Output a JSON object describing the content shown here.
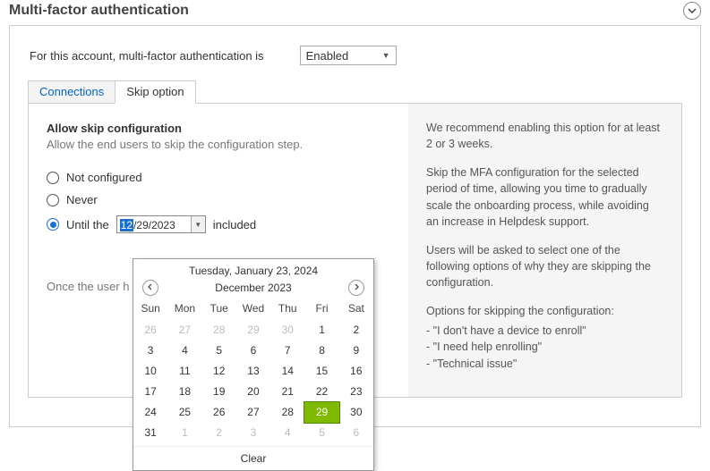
{
  "header": {
    "title": "Multi-factor authentication"
  },
  "top": {
    "label": "For this account, multi-factor authentication is",
    "status_value": "Enabled"
  },
  "tabs": [
    {
      "label": "Connections"
    },
    {
      "label": "Skip option"
    }
  ],
  "skip": {
    "heading": "Allow skip configuration",
    "sub": "Allow the end users to skip the configuration step.",
    "options": {
      "not_configured": "Not configured",
      "never": "Never",
      "until": "Until the",
      "included": "included"
    },
    "date": {
      "selected_segment": "12",
      "rest": "/29/2023"
    },
    "hint_truncated": "Once the user h"
  },
  "info": {
    "p1": "We recommend enabling this option for at least 2 or 3 weeks.",
    "p2": "Skip the MFA configuration for the selected period of time, allowing you time to gradually scale the onboarding process, while avoiding an increase in Helpdesk support.",
    "p3": "Users will be asked to select one of the following options of why they are skipping the configuration.",
    "opts_label": "Options for skipping the configuration:",
    "opts": [
      "\"I don't have a device to enroll\"",
      "\"I need help enrolling\"",
      "\"Technical issue\""
    ]
  },
  "datepicker": {
    "today_line": "Tuesday, January 23, 2024",
    "month_label": "December 2023",
    "dow": [
      "Sun",
      "Mon",
      "Tue",
      "Wed",
      "Thu",
      "Fri",
      "Sat"
    ],
    "weeks": [
      [
        {
          "d": 26,
          "o": true
        },
        {
          "d": 27,
          "o": true
        },
        {
          "d": 28,
          "o": true
        },
        {
          "d": 29,
          "o": true
        },
        {
          "d": 30,
          "o": true
        },
        {
          "d": 1
        },
        {
          "d": 2
        }
      ],
      [
        {
          "d": 3
        },
        {
          "d": 4
        },
        {
          "d": 5
        },
        {
          "d": 6
        },
        {
          "d": 7
        },
        {
          "d": 8
        },
        {
          "d": 9
        }
      ],
      [
        {
          "d": 10
        },
        {
          "d": 11
        },
        {
          "d": 12
        },
        {
          "d": 13
        },
        {
          "d": 14
        },
        {
          "d": 15
        },
        {
          "d": 16
        }
      ],
      [
        {
          "d": 17
        },
        {
          "d": 18
        },
        {
          "d": 19
        },
        {
          "d": 20
        },
        {
          "d": 21
        },
        {
          "d": 22
        },
        {
          "d": 23
        }
      ],
      [
        {
          "d": 24
        },
        {
          "d": 25
        },
        {
          "d": 26
        },
        {
          "d": 27
        },
        {
          "d": 28
        },
        {
          "d": 29,
          "sel": true
        },
        {
          "d": 30
        }
      ],
      [
        {
          "d": 31
        },
        {
          "d": 1,
          "o": true
        },
        {
          "d": 2,
          "o": true
        },
        {
          "d": 3,
          "o": true
        },
        {
          "d": 4,
          "o": true
        },
        {
          "d": 5,
          "o": true
        },
        {
          "d": 6,
          "o": true
        }
      ]
    ],
    "clear_label": "Clear"
  }
}
